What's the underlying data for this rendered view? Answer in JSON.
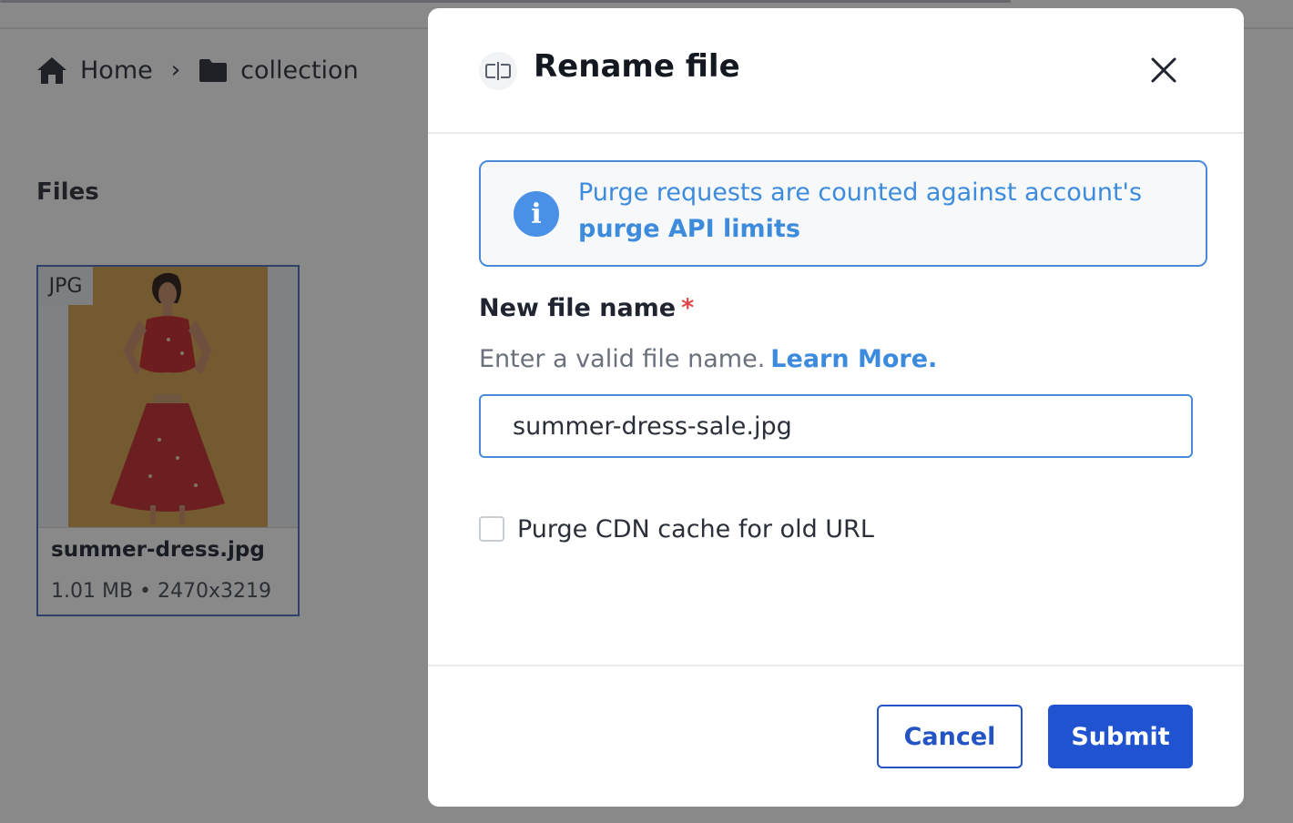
{
  "breadcrumb": {
    "home_label": "Home",
    "folder_label": "collection",
    "separator": "›"
  },
  "files": {
    "heading": "Files",
    "items": [
      {
        "type_badge": "JPG",
        "name": "summer-dress.jpg",
        "meta": "1.01 MB • 2470x3219"
      }
    ]
  },
  "modal": {
    "title": "Rename file",
    "info": {
      "text": "Purge requests are counted against account's",
      "link": "purge API limits"
    },
    "field": {
      "label": "New file name",
      "required_marker": "*",
      "help_text": "Enter a valid file name.",
      "help_link": "Learn More.",
      "value": "summer-dress-sale.jpg"
    },
    "checkbox": {
      "label": "Purge CDN cache for old URL",
      "checked": false
    },
    "buttons": {
      "cancel": "Cancel",
      "submit": "Submit"
    }
  },
  "colors": {
    "accent": "#1f53cf",
    "link": "#3d8bdc",
    "info_border": "#4a8ad8",
    "required": "#e04848",
    "overlay": "rgba(20,20,20,0.5)"
  }
}
